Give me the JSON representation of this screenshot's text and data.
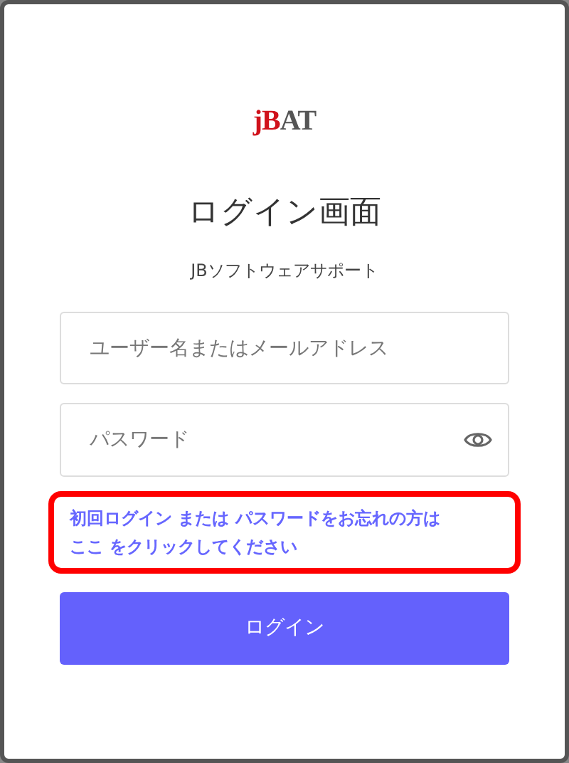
{
  "logo": {
    "accent": "jB",
    "rest": "AT"
  },
  "title": "ログイン画面",
  "subtitle": "JBソフトウェアサポート",
  "username_field": {
    "placeholder": "ユーザー名またはメールアドレス"
  },
  "password_field": {
    "placeholder": "パスワード"
  },
  "help_text": {
    "lines": [
      "初回ログイン または パスワードをお忘れの方は",
      "ここ をクリックしてください"
    ],
    "highlighted": true
  },
  "login_button": {
    "label": "ログイン"
  }
}
